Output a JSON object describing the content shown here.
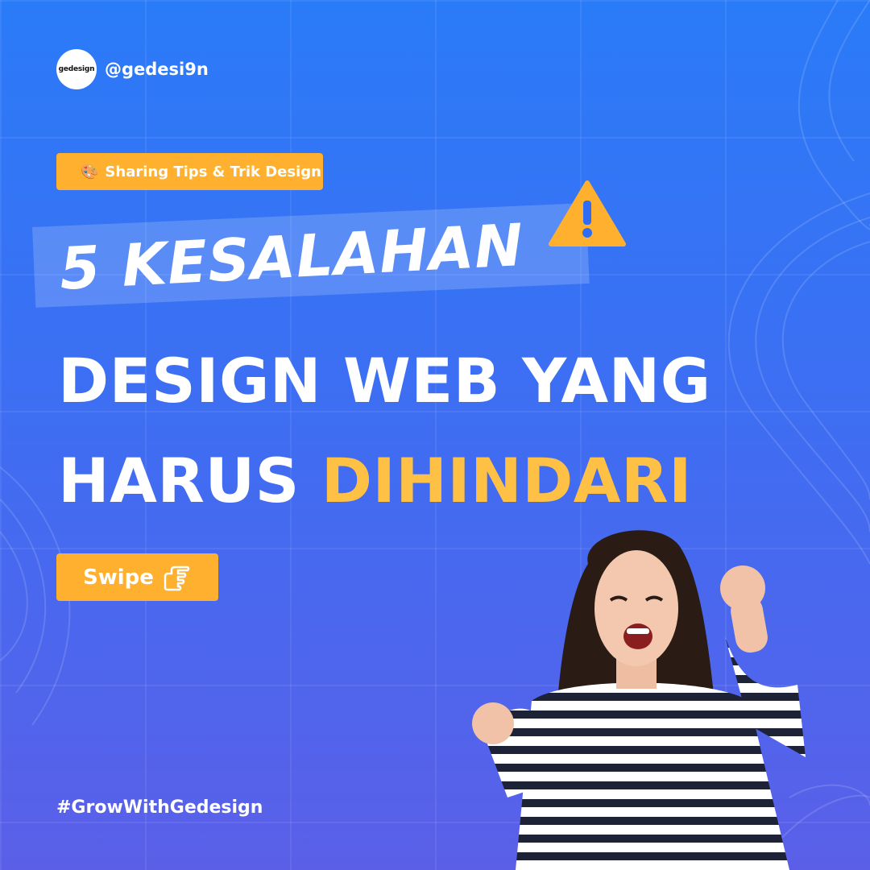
{
  "brand": {
    "logo_text": "gedesign",
    "handle": "@gedesi9n"
  },
  "tag": {
    "label": "Sharing Tips & Trik Design",
    "icon": "palette-icon"
  },
  "headline": {
    "line1": "5 KESALAHAN",
    "line2": "DESIGN WEB YANG",
    "line3_main": "HARUS ",
    "line3_accent": "DIHINDARI",
    "warning_icon": "warning-icon"
  },
  "cta": {
    "label": "Swipe",
    "icon": "pointing-hand-icon"
  },
  "footer": {
    "hashtag": "#GrowWithGedesign"
  },
  "photo": {
    "subject": "excited-woman-photo"
  },
  "colors": {
    "background_top": "#2a7bf8",
    "background_bottom": "#5b5fe8",
    "accent": "#ffb02e",
    "highlight_text": "#ffc145",
    "text": "#ffffff"
  }
}
